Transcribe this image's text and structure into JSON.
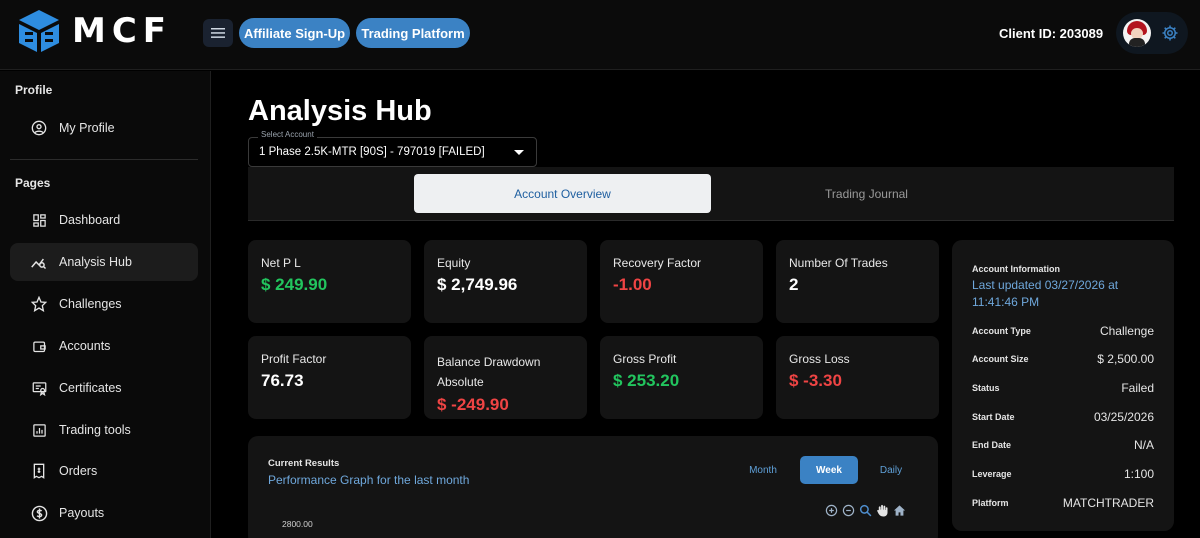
{
  "header": {
    "logo_text": "MCF",
    "affiliate_label": "Affiliate Sign-Up",
    "trading_platform_label": "Trading Platform",
    "client_id": "Client ID: 203089"
  },
  "sidebar": {
    "profile_title": "Profile",
    "profile_items": [
      {
        "label": "My Profile",
        "icon": "user-circle-icon"
      }
    ],
    "pages_title": "Pages",
    "pages_items": [
      {
        "label": "Dashboard",
        "icon": "dashboard-icon"
      },
      {
        "label": "Analysis Hub",
        "icon": "analysis-icon",
        "active": true
      },
      {
        "label": "Challenges",
        "icon": "star-icon"
      },
      {
        "label": "Accounts",
        "icon": "wallet-icon"
      },
      {
        "label": "Certificates",
        "icon": "certificate-icon"
      },
      {
        "label": "Trading tools",
        "icon": "bar-chart-icon"
      },
      {
        "label": "Orders",
        "icon": "receipt-icon"
      },
      {
        "label": "Payouts",
        "icon": "dollar-icon"
      }
    ]
  },
  "main": {
    "title": "Analysis Hub",
    "select_label": "Select Account",
    "select_value": "1 Phase 2.5K-MTR [90S] - 797019 [FAILED]",
    "tabs": [
      {
        "label": "Account Overview",
        "active": true
      },
      {
        "label": "Trading Journal",
        "active": false
      }
    ],
    "stats": [
      {
        "label": "Net P L",
        "value": "$ 249.90",
        "color": "#22c55e"
      },
      {
        "label": "Equity",
        "value": "$ 2,749.96",
        "color": "#ffffff"
      },
      {
        "label": "Recovery Factor",
        "value": "-1.00",
        "color": "#ef4444"
      },
      {
        "label": "Number Of Trades",
        "value": "2",
        "color": "#ffffff"
      },
      {
        "label": "Profit Factor",
        "value": "76.73",
        "color": "#ffffff"
      },
      {
        "label": "Balance Drawdown Absolute",
        "value": "$ -249.90",
        "color": "#ef4444"
      },
      {
        "label": "Gross Profit",
        "value": "$ 253.20",
        "color": "#22c55e"
      },
      {
        "label": "Gross Loss",
        "value": "$ -3.30",
        "color": "#ef4444"
      }
    ],
    "account_info": {
      "title": "Account Information",
      "updated": "Last updated 03/27/2026 at 11:41:46 PM",
      "rows": [
        {
          "key": "Account Type",
          "value": "Challenge"
        },
        {
          "key": "Account Size",
          "value": "$ 2,500.00"
        },
        {
          "key": "Status",
          "value": "Failed"
        },
        {
          "key": "Start Date",
          "value": "03/25/2026"
        },
        {
          "key": "End Date",
          "value": "N/A"
        },
        {
          "key": "Leverage",
          "value": "1:100"
        },
        {
          "key": "Platform",
          "value": "MATCHTRADER"
        }
      ]
    },
    "results": {
      "title": "Current Results",
      "subtitle": "Performance Graph for the last month",
      "ranges": [
        "Month",
        "Week",
        "Daily"
      ],
      "selected_range": "Week",
      "y_top_tick": "2800.00"
    }
  }
}
